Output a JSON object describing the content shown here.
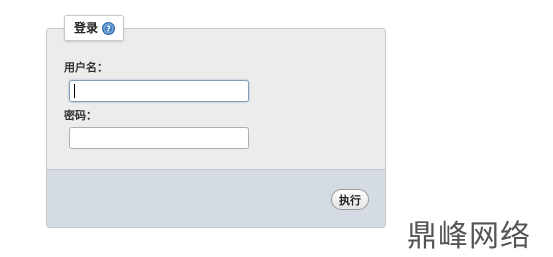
{
  "panel": {
    "tab_label": "登录",
    "help_icon": "question-circle-icon",
    "accent_color": "#4a86c5"
  },
  "form": {
    "username_label": "用户名：",
    "username_value": "",
    "password_label": "密码：",
    "password_value": ""
  },
  "footer": {
    "execute_label": "执行"
  },
  "watermark": {
    "text": "鼎峰网络"
  }
}
